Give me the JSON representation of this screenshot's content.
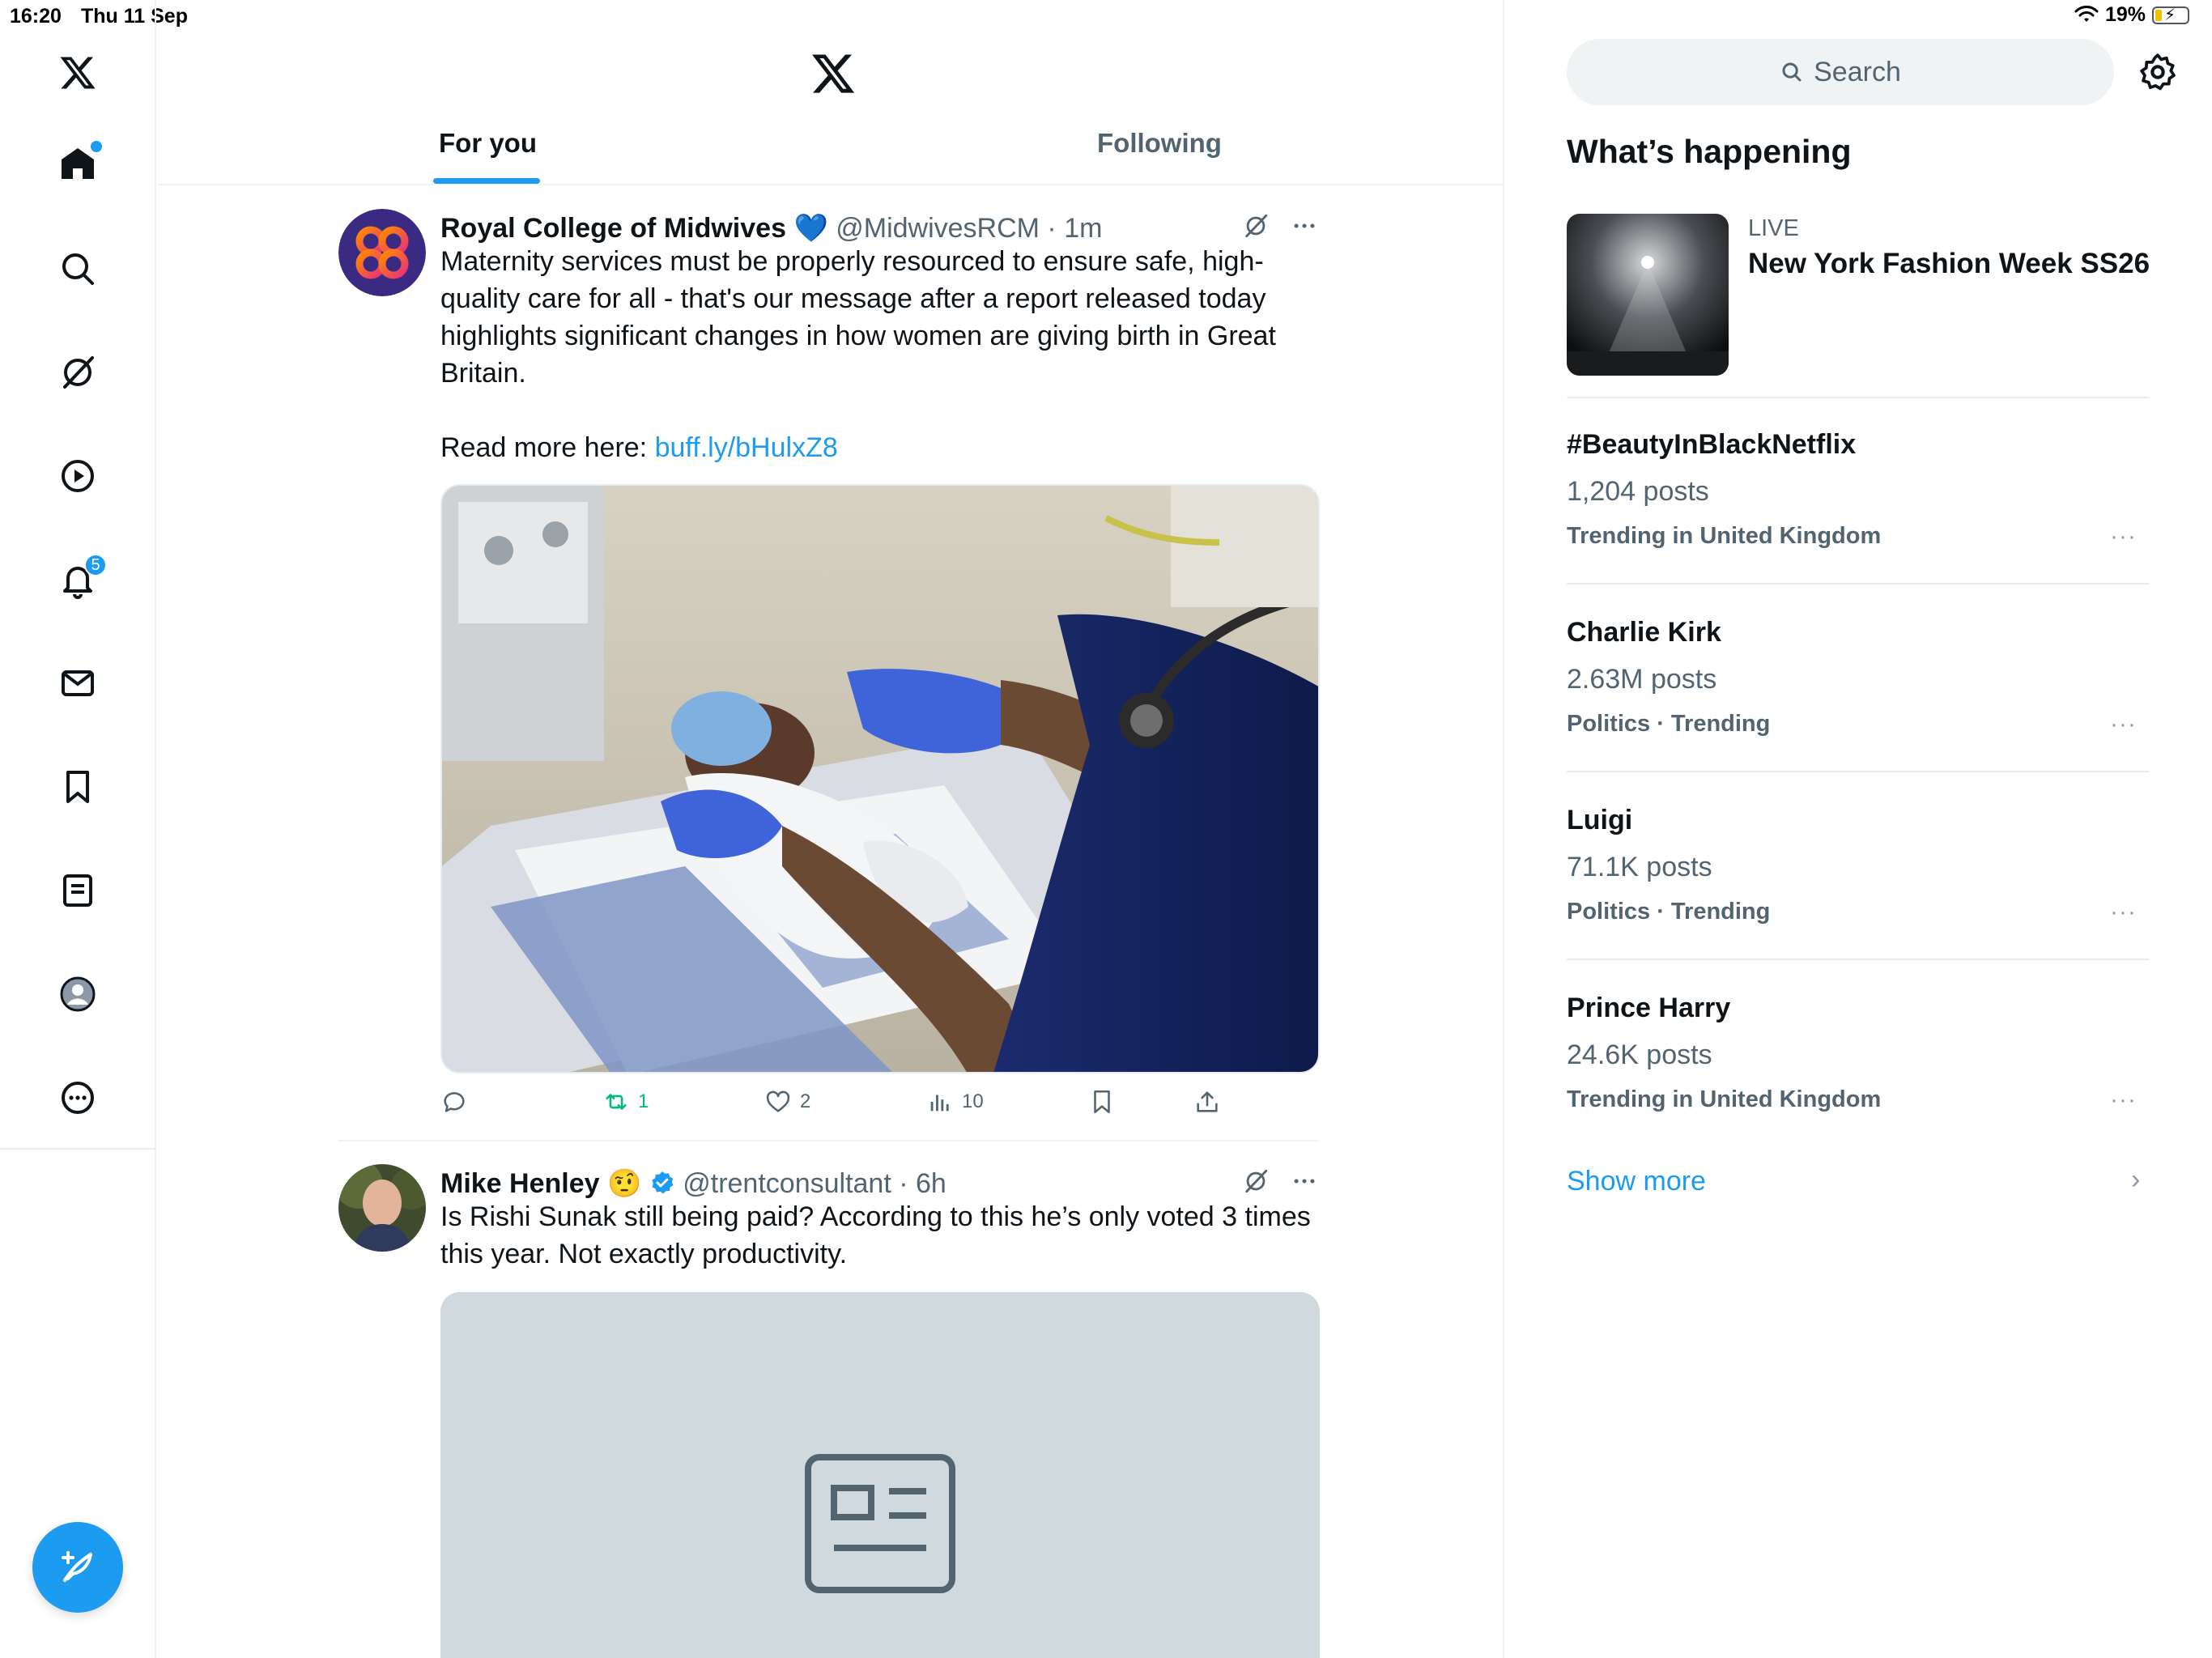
{
  "status_bar": {
    "time": "16:20",
    "date": "Thu 11 Sep",
    "battery": "19%",
    "battery_level": 0.19
  },
  "nav": {
    "items": [
      {
        "name": "home",
        "icon": "home-icon"
      },
      {
        "name": "explore",
        "icon": "search-icon"
      },
      {
        "name": "grok",
        "icon": "grok-icon"
      },
      {
        "name": "video",
        "icon": "play-icon"
      },
      {
        "name": "notifications",
        "icon": "bell-icon",
        "badge": "5"
      },
      {
        "name": "messages",
        "icon": "mail-icon"
      },
      {
        "name": "bookmarks",
        "icon": "bookmark-icon"
      },
      {
        "name": "lists",
        "icon": "list-icon"
      },
      {
        "name": "profile",
        "icon": "profile-icon"
      },
      {
        "name": "more",
        "icon": "more-circle-icon"
      }
    ],
    "compose_icon": "feather-plus-icon"
  },
  "tabs": [
    {
      "label": "For you",
      "active": true
    },
    {
      "label": "Following",
      "active": false
    }
  ],
  "posts": [
    {
      "name": "Royal College of Midwives",
      "name_emoji": "💙",
      "handle": "@MidwivesRCM",
      "time": "1m",
      "text": "Maternity services must be properly resourced to ensure safe, high-quality care for all - that's our message after a report released today highlights significant changes in how women are giving birth in Great Britain.",
      "read_more_prefix": "Read more here: ",
      "link": "buff.ly/bHulxZ8",
      "stats": {
        "replies": "",
        "reposts": "1",
        "likes": "2",
        "views": "10"
      }
    },
    {
      "name": "Mike Henley",
      "name_emoji": "🤨",
      "verified": true,
      "handle": "@trentconsultant",
      "time": "6h",
      "text": "Is Rishi Sunak still being paid? According to this he’s only voted 3 times this year. Not exactly productivity.",
      "media_icon": "article-icon"
    }
  ],
  "sidebar": {
    "search_placeholder": "Search",
    "section_title": "What’s happening",
    "live": {
      "label": "LIVE",
      "title": "New York Fashion Week SS26"
    },
    "trends": [
      {
        "name": "#BeautyInBlackNetflix",
        "count": "1,204 posts",
        "context": "Trending in United Kingdom"
      },
      {
        "name": "Charlie Kirk",
        "count": "2.63M posts",
        "context": "Politics · Trending"
      },
      {
        "name": "Luigi",
        "count": "71.1K posts",
        "context": "Politics · Trending"
      },
      {
        "name": "Prince Harry",
        "count": "24.6K posts",
        "context": "Trending in United Kingdom"
      }
    ],
    "more_label": "···",
    "show_more": "Show more"
  },
  "colors": {
    "accent": "#1d9bf0",
    "text": "#0f1419",
    "secondary": "#536471",
    "repost_green": "#00ba7c"
  }
}
